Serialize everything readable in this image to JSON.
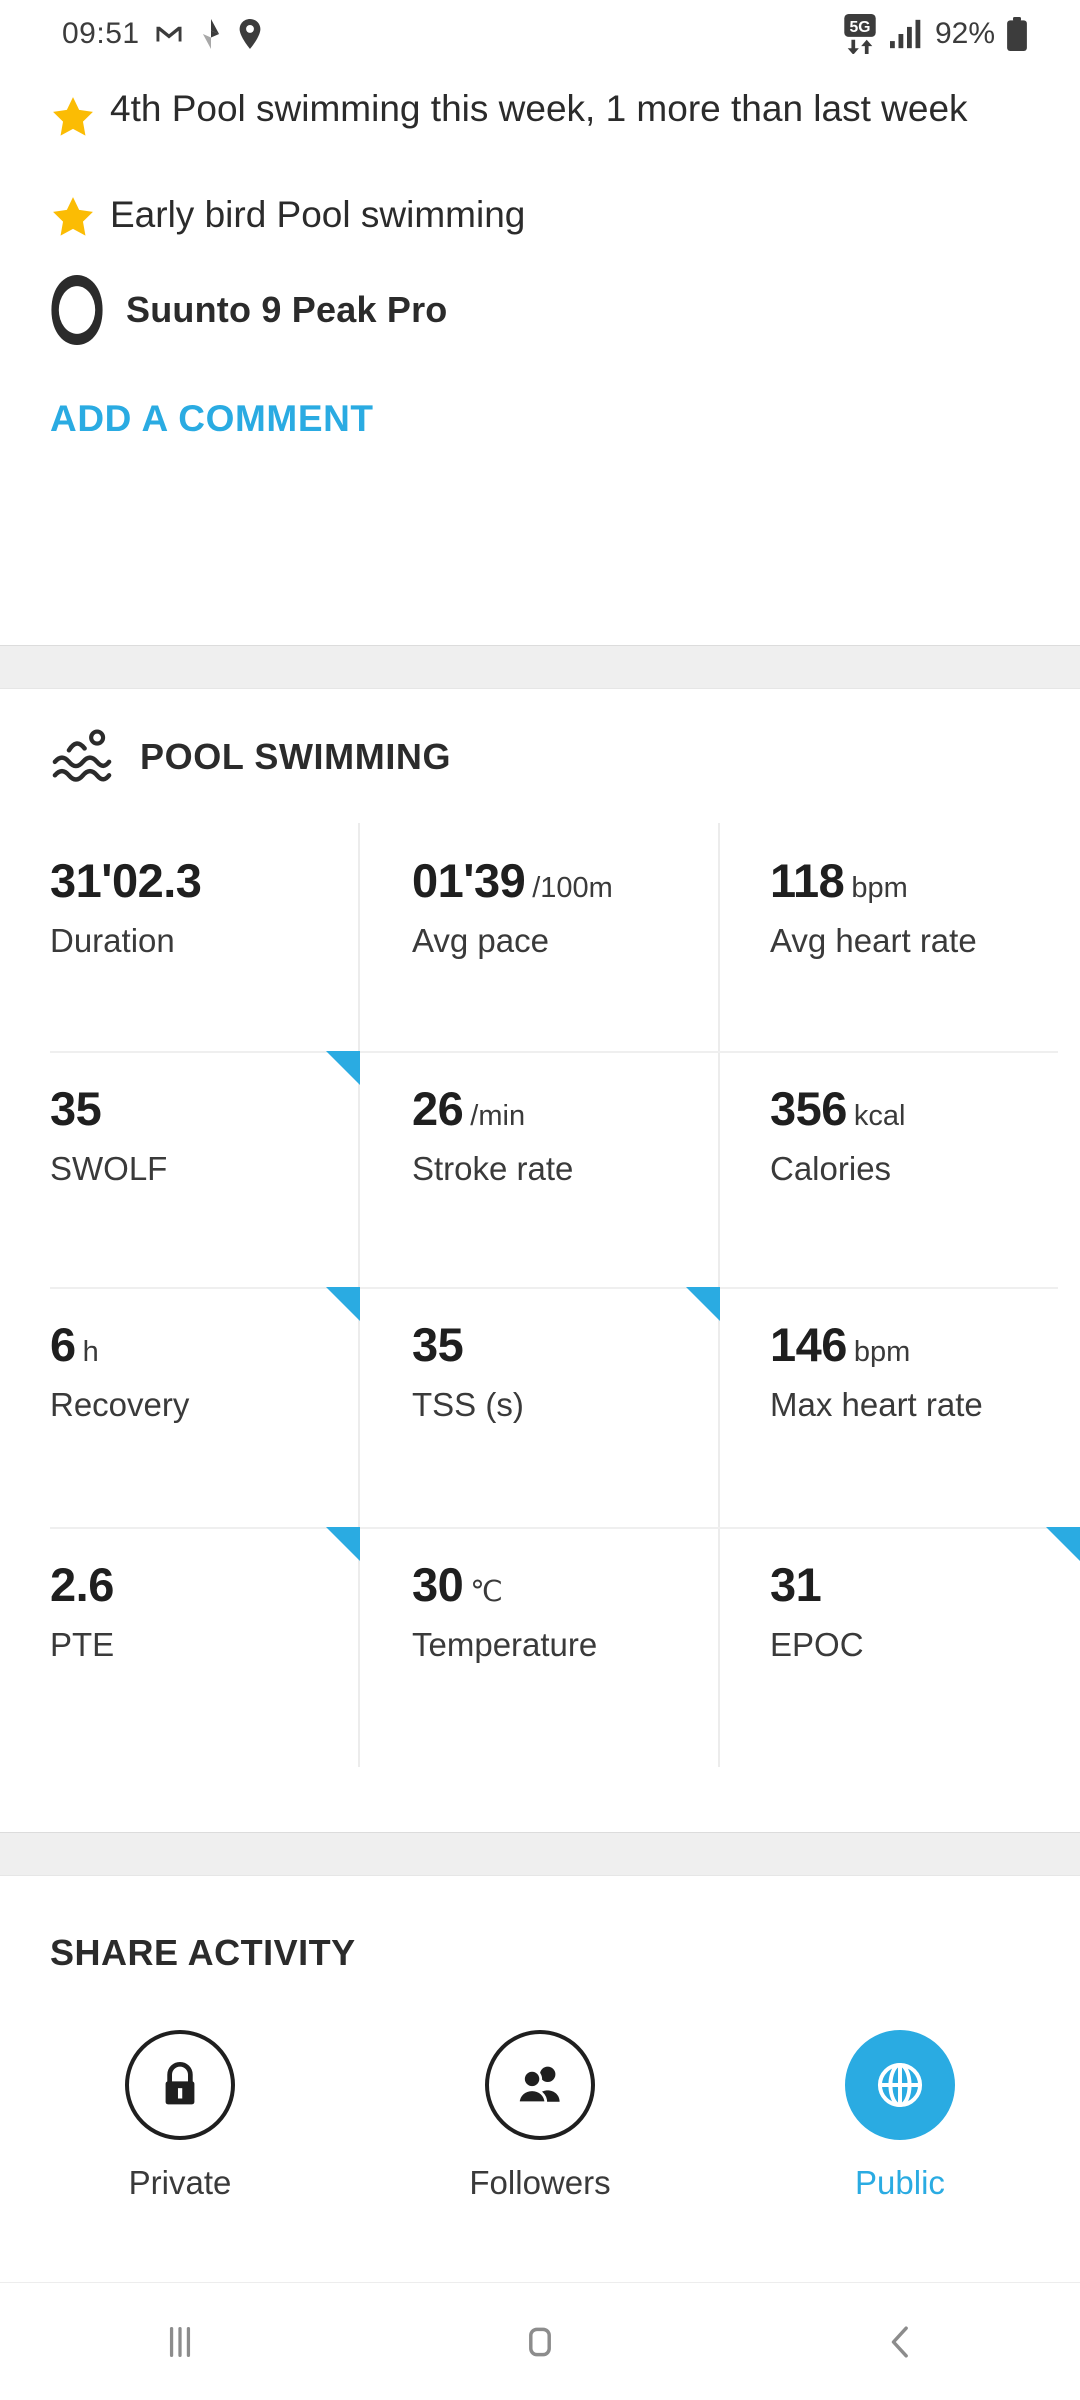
{
  "status_bar": {
    "time": "09:51",
    "battery_percent": "92%",
    "icons": [
      "gmail-icon",
      "navigation-arrow-icon",
      "location-pin-icon",
      "5g-data-icon",
      "signal-bars-icon",
      "battery-icon"
    ]
  },
  "highlights": {
    "items": [
      {
        "icon": "star-icon",
        "text": "4th Pool swimming this week, 1 more than last week"
      },
      {
        "icon": "star-icon",
        "text": "Early bird Pool swimming"
      }
    ],
    "device": {
      "icon": "watch-icon",
      "name": "Suunto 9 Peak Pro"
    },
    "comment_label": "ADD A COMMENT"
  },
  "activity": {
    "icon": "pool-swimming-icon",
    "title": "POOL SWIMMING",
    "stats": [
      {
        "value": "31'02.3",
        "unit": "",
        "label": "Duration",
        "marker": false
      },
      {
        "value": "01'39",
        "unit": "/100m",
        "label": "Avg pace",
        "marker": false
      },
      {
        "value": "118",
        "unit": "bpm",
        "label": "Avg heart rate",
        "marker": false
      },
      {
        "value": "35",
        "unit": "",
        "label": "SWOLF",
        "marker": false
      },
      {
        "value": "26",
        "unit": "/min",
        "label": "Stroke rate",
        "marker": true
      },
      {
        "value": "356",
        "unit": "kcal",
        "label": "Calories",
        "marker": false
      },
      {
        "value": "6",
        "unit": "h",
        "label": "Recovery",
        "marker": false
      },
      {
        "value": "35",
        "unit": "",
        "label": "TSS (s)",
        "marker": true
      },
      {
        "value": "146",
        "unit": "bpm",
        "label": "Max heart rate",
        "marker": true
      },
      {
        "value": "2.6",
        "unit": "",
        "label": "PTE",
        "marker": false
      },
      {
        "value": "30",
        "unit": "℃",
        "label": "Temperature",
        "marker": true
      },
      {
        "value": "31",
        "unit": "",
        "label": "EPOC",
        "marker": true
      }
    ]
  },
  "share": {
    "title": "SHARE ACTIVITY",
    "options": [
      {
        "icon": "lock-icon",
        "label": "Private",
        "selected": false
      },
      {
        "icon": "people-icon",
        "label": "Followers",
        "selected": false
      },
      {
        "icon": "globe-icon",
        "label": "Public",
        "selected": true
      }
    ]
  },
  "navbar": {
    "buttons": [
      {
        "icon": "recents-icon",
        "label": "Recents"
      },
      {
        "icon": "home-icon",
        "label": "Home"
      },
      {
        "icon": "back-icon",
        "label": "Back"
      }
    ]
  },
  "colors": {
    "accent": "#2aabe2",
    "star": "#fbbc04",
    "text": "#2b2b2b",
    "divider": "#efefef"
  }
}
